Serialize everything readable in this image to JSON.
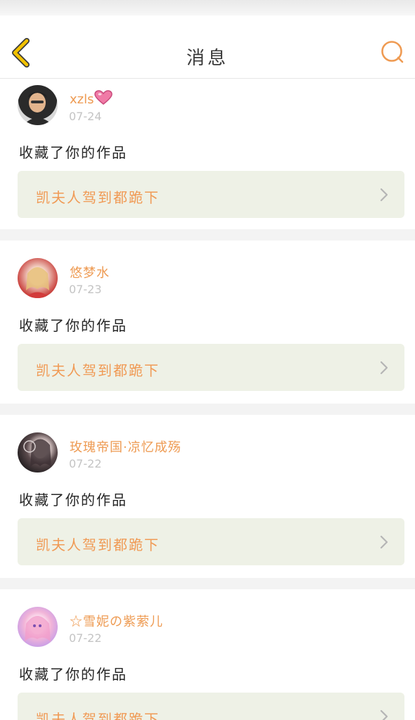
{
  "header": {
    "title": "消息"
  },
  "colors": {
    "accent": "#ee9b53",
    "work_bg": "#eef1e6",
    "back_icon": "#f2c200"
  },
  "messages": [
    {
      "username": "xzls",
      "badge": "heart-icon",
      "date": "07-24",
      "action": "收藏了你的作品",
      "work": "凯夫人驾到都跪下"
    },
    {
      "username": "悠梦水",
      "date": "07-23",
      "action": "收藏了你的作品",
      "work": "凯夫人驾到都跪下"
    },
    {
      "username": "玫瑰帝国·凉忆成殇",
      "date": "07-22",
      "action": "收藏了你的作品",
      "work": "凯夫人驾到都跪下"
    },
    {
      "username": "☆雪妮の紫萦儿",
      "date": "07-22",
      "action": "收藏了你的作品",
      "work": "凯夫人驾到都跪下"
    }
  ]
}
